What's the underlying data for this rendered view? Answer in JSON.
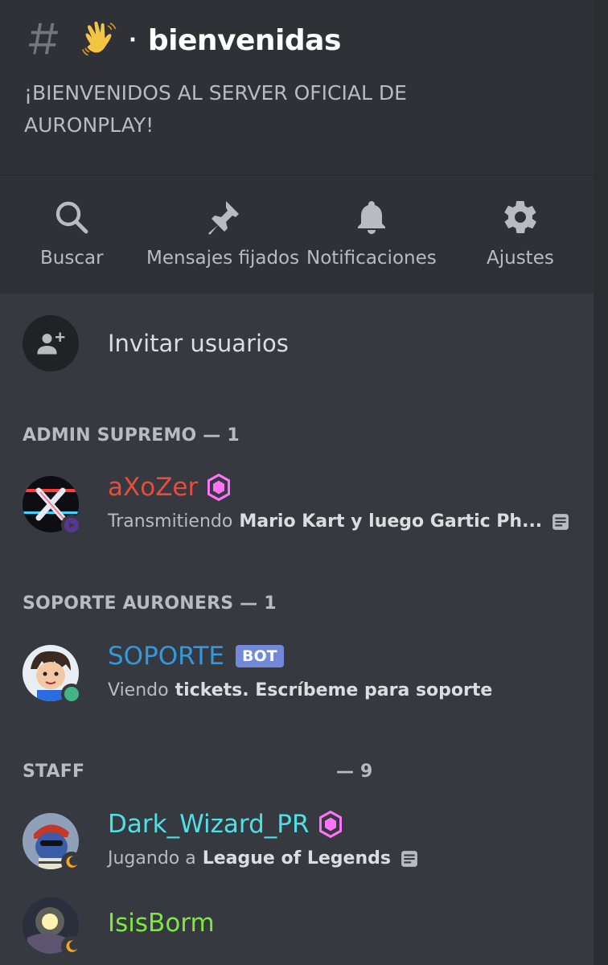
{
  "header": {
    "channel_name": "bienvenidas",
    "separator": "·",
    "topic": "¡BIENVENIDOS AL SERVER OFICIAL DE AURONPLAY!"
  },
  "actions": [
    {
      "label": "Buscar",
      "icon": "search-icon"
    },
    {
      "label": "Mensajes fijados",
      "icon": "pin-icon"
    },
    {
      "label": "Notificaciones",
      "icon": "bell-icon"
    },
    {
      "label": "Ajustes",
      "icon": "gear-icon"
    }
  ],
  "invite": {
    "label": "Invitar usuarios"
  },
  "sections": [
    {
      "title": "ADMIN SUPREMO — 1",
      "members": [
        {
          "name": "aXoZer",
          "name_color": "#e74c3c",
          "status_prefix": "Transmitiendo",
          "status_bold": "Mario Kart y luego Gartic Ph...",
          "status_color": "#593695"
        }
      ]
    },
    {
      "title": "SOPORTE AURONERS — 1",
      "members": [
        {
          "name": "SOPORTE",
          "name_color": "#3498db",
          "tag": "BOT",
          "status_prefix": "Viendo",
          "status_bold": "tickets. Escríbeme para soporte",
          "status_color": "#43b581"
        }
      ]
    },
    {
      "title": "STAFF",
      "count": "— 9",
      "members": [
        {
          "name": "Dark_Wizard_PR",
          "name_color": "#1abc9c",
          "status_prefix": "Jugando a",
          "status_bold": "League of Legends",
          "status_color": "#faa61a"
        },
        {
          "name": "IsisBorm",
          "name_color": "#2ecc71",
          "status_color": "#faa61a"
        }
      ]
    }
  ],
  "colors": {
    "background": "#36393f",
    "header_bg": "#2f3136",
    "boost": "#ff73fa",
    "bot_tag": "#7289da"
  }
}
